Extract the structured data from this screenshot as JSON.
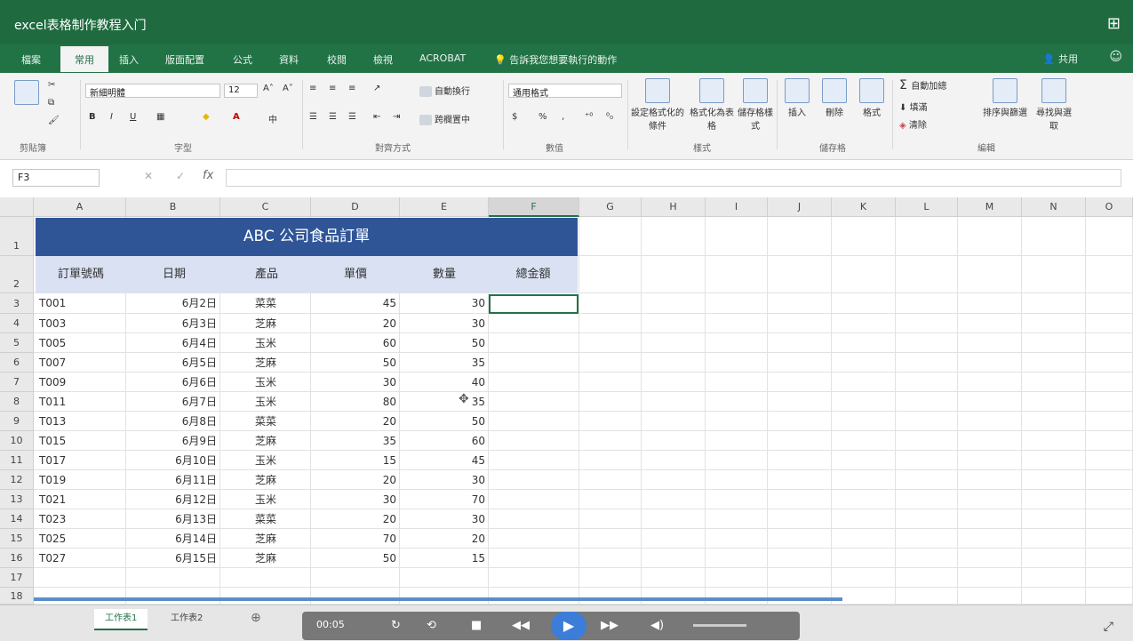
{
  "window": {
    "title": "excel表格制作教程入门"
  },
  "ribbon_tabs": [
    {
      "label": "檔案"
    },
    {
      "label": "常用"
    },
    {
      "label": "插入"
    },
    {
      "label": "版面配置"
    },
    {
      "label": "公式"
    },
    {
      "label": "資料"
    },
    {
      "label": "校閱"
    },
    {
      "label": "檢視"
    },
    {
      "label": "ACROBAT"
    }
  ],
  "tell_me": "告訴我您想要執行的動作",
  "user": "共用",
  "ribbon": {
    "groups": [
      "剪貼簿",
      "字型",
      "對齊方式",
      "數值",
      "樣式",
      "儲存格",
      "編輯"
    ],
    "font_name": "新細明體",
    "font_size": "12",
    "number_format": "通用格式",
    "wrap_text": "自動換行",
    "merge_center": "跨欄置中",
    "cond_format": "設定格式化的條件",
    "format_table": "格式化為表格",
    "cell_styles": "儲存格樣式",
    "insert": "插入",
    "delete": "刪除",
    "format": "格式",
    "autosum": "自動加總",
    "fill": "填滿",
    "clear": "清除",
    "sort_filter": "排序與篩選",
    "find_select": "尋找與選取"
  },
  "formula_bar": {
    "name_box": "F3",
    "fx": "fx",
    "formula": ""
  },
  "columns": [
    "A",
    "B",
    "C",
    "D",
    "E",
    "F",
    "G",
    "H",
    "I",
    "J",
    "K",
    "L",
    "M",
    "N",
    "O"
  ],
  "row_numbers": [
    "1",
    "2",
    "3",
    "4",
    "5",
    "6",
    "7",
    "8",
    "9",
    "10",
    "11",
    "12",
    "13",
    "14",
    "15",
    "16",
    "17",
    "18"
  ],
  "table": {
    "title": "ABC 公司食品訂單",
    "headers": [
      "訂單號碼",
      "日期",
      "產品",
      "單價",
      "數量",
      "總金額"
    ],
    "rows": [
      [
        "T001",
        "6月2日",
        "菜菜",
        "45",
        "30"
      ],
      [
        "T003",
        "6月3日",
        "芝麻",
        "20",
        "30"
      ],
      [
        "T005",
        "6月4日",
        "玉米",
        "60",
        "50"
      ],
      [
        "T007",
        "6月5日",
        "芝麻",
        "50",
        "35"
      ],
      [
        "T009",
        "6月6日",
        "玉米",
        "30",
        "40"
      ],
      [
        "T011",
        "6月7日",
        "玉米",
        "80",
        "35"
      ],
      [
        "T013",
        "6月8日",
        "菜菜",
        "20",
        "50"
      ],
      [
        "T015",
        "6月9日",
        "芝麻",
        "35",
        "60"
      ],
      [
        "T017",
        "6月10日",
        "玉米",
        "15",
        "45"
      ],
      [
        "T019",
        "6月11日",
        "芝麻",
        "20",
        "30"
      ],
      [
        "T021",
        "6月12日",
        "玉米",
        "30",
        "70"
      ],
      [
        "T023",
        "6月13日",
        "菜菜",
        "20",
        "30"
      ],
      [
        "T025",
        "6月14日",
        "芝麻",
        "70",
        "20"
      ],
      [
        "T027",
        "6月15日",
        "芝麻",
        "50",
        "15"
      ]
    ]
  },
  "sheets": [
    "工作表1",
    "工作表2"
  ],
  "player": {
    "time": "00:05"
  },
  "colors": {
    "excel_green": "#217346",
    "title_fill": "#2f5597",
    "header_fill": "#d9e1f2"
  }
}
